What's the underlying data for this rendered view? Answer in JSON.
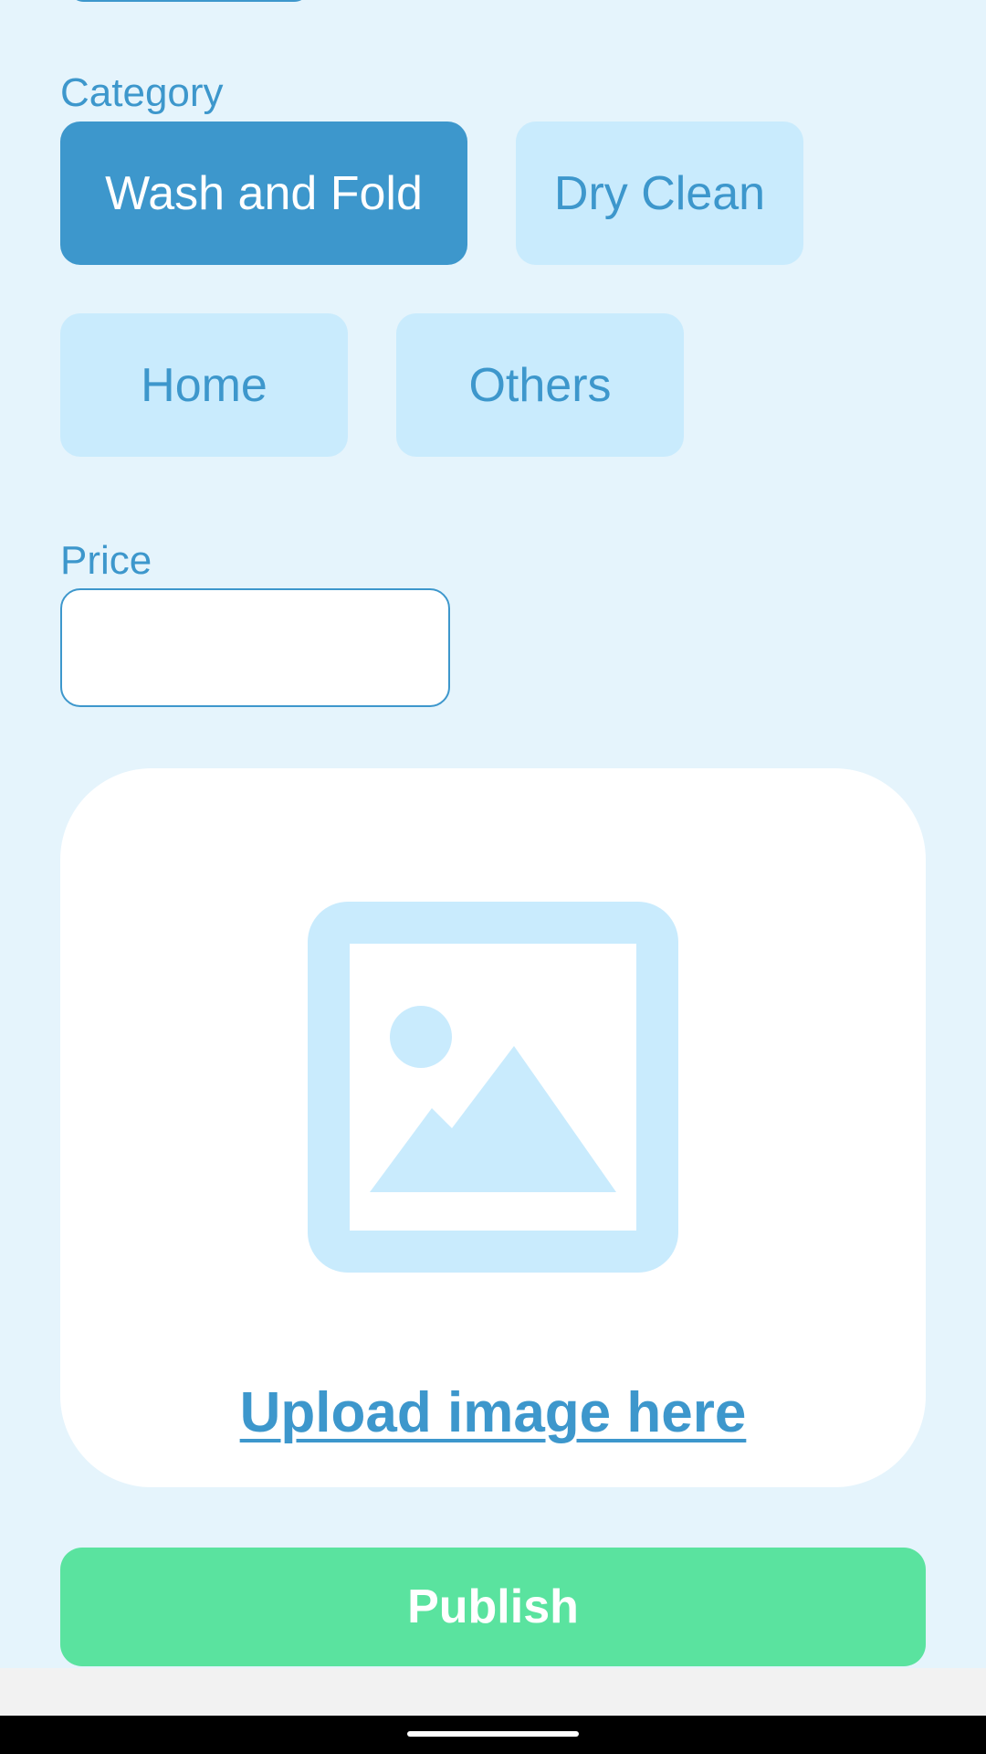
{
  "category": {
    "label": "Category",
    "options": [
      {
        "label": "Wash and Fold",
        "selected": true
      },
      {
        "label": "Dry Clean",
        "selected": false
      },
      {
        "label": "Home",
        "selected": false
      },
      {
        "label": "Others",
        "selected": false
      }
    ]
  },
  "price": {
    "label": "Price",
    "value": "",
    "placeholder": ""
  },
  "upload": {
    "icon": "image-placeholder-icon",
    "link_label": "Upload image here"
  },
  "publish": {
    "label": "Publish"
  },
  "colors": {
    "background": "#e5f4fc",
    "accent": "#3d97cc",
    "chip_background": "#c9ebfd",
    "publish_button": "#5ae39f",
    "card": "#ffffff"
  }
}
